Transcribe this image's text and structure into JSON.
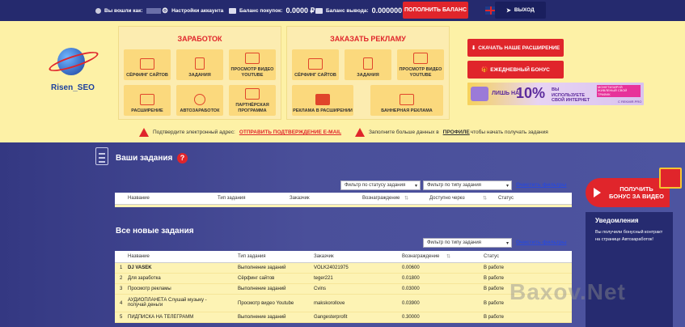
{
  "header": {
    "logged_in": "Вы вошли как:",
    "settings": "Настройки аккаунта",
    "balance_buy_label": "Баланс покупок:",
    "balance_buy_value": "0.0000 ₽",
    "balance_out_label": "Баланс вывода:",
    "balance_out_value": "0.000000 ₽",
    "topup": "ПОПОЛНИТЬ БАЛАНС",
    "logout": "ВЫХОД"
  },
  "logo": {
    "part1": "Risen",
    "part2": "SEO"
  },
  "earn": {
    "title": "ЗАРАБОТОК",
    "tiles": [
      "СЁРФИНГ САЙТОВ",
      "ЗАДАНИЯ",
      "ПРОСМОТР ВИДЕО YOUTUBE",
      "РАСШИРЕНИЕ",
      "АВТОЗАРАБОТОК",
      "ПАРТНЁРСКАЯ ПРОГРАММА"
    ]
  },
  "ads": {
    "title": "ЗАКАЗАТЬ РЕКЛАМУ",
    "tiles": [
      "СЁРФИНГ САЙТОВ",
      "ЗАДАНИЯ",
      "ПРОСМОТР ВИДЕО YOUTUBE",
      "РЕКЛАМА В РАСШИРЕНИИ",
      "БАННЕРНАЯ РЕКЛАМА"
    ]
  },
  "right": {
    "download": "СКАЧАТЬ НАШЕ РАСШИРЕНИЕ",
    "bonus": "ЕЖЕДНЕВНЫЙ БОНУС",
    "banner": {
      "lead": "ЛИШЬ НА",
      "pct": "10%",
      "text": "ВЫ ИСПОЛЬЗУЕТЕ СВОЙ ИНТЕРНЕТ",
      "tag": "МОНЕТИЗИРУЙ ЖИВЛЕНЫЙ СВОЙ ТРАФИК",
      "brand": "С REKMIR.PRO"
    }
  },
  "warnings": {
    "w1": "Подтвердите электронный адрес:",
    "w1_link": "ОТПРАВИТЬ ПОДТВЕРЖДЕНИЕ E-MAIL",
    "w2_pre": "Заполните больше данных в",
    "w2_link": "ПРОФИЛЕ",
    "w2_post": "чтобы начать получать задания"
  },
  "my_tasks": {
    "title": "Ваши задания",
    "filter_status": "Фильтр по статусу задания",
    "filter_type": "Фильтр по типу задания",
    "clear": "Очистить фильтры",
    "cols": [
      "Название",
      "Тип задания",
      "Заказчик",
      "Вознаграждение",
      "Доступно через",
      "Статус"
    ]
  },
  "new_tasks": {
    "title": "Все новые задания",
    "filter_type": "Фильтр по типу задания",
    "clear": "Очистить фильтры",
    "cols": [
      "Название",
      "Тип задания",
      "Заказчик",
      "Вознаграждение",
      "Статус"
    ],
    "rows": [
      {
        "n": "1",
        "name": "DJ VASEK",
        "type": "Выполнение заданий",
        "client": "VOLK24021975",
        "reward": "0.00600",
        "status": "В работе"
      },
      {
        "n": "2",
        "name": "Для заработка",
        "type": "Сёрфинг сайтов",
        "client": "teger221",
        "reward": "0.01800",
        "status": "В работе"
      },
      {
        "n": "3",
        "name": "Просмотр рекламы",
        "type": "Выполнение заданий",
        "client": "Cvins",
        "reward": "0.03000",
        "status": "В работе"
      },
      {
        "n": "4",
        "name": "АУДИОПЛАНЕТА Слушай музыку - получай деньги",
        "type": "Просмотр видео Youtube",
        "client": "makskorollove",
        "reward": "0.03900",
        "status": "В работе"
      },
      {
        "n": "5",
        "name": "ПИДПИСКА НА ТЕЛЕГРАММ",
        "type": "Выполнение заданий",
        "client": "Gangesterprofit",
        "reward": "0.30000",
        "status": "В работе"
      }
    ]
  },
  "side": {
    "get_bonus": "ПОЛУЧИТЬ БОНУС ЗА ВИДЕО",
    "notif_title": "Уведомления",
    "notif_text": "Вы получили бонусный контракт на странице Автозаработок!"
  },
  "watermark": "Baxov.Net"
}
